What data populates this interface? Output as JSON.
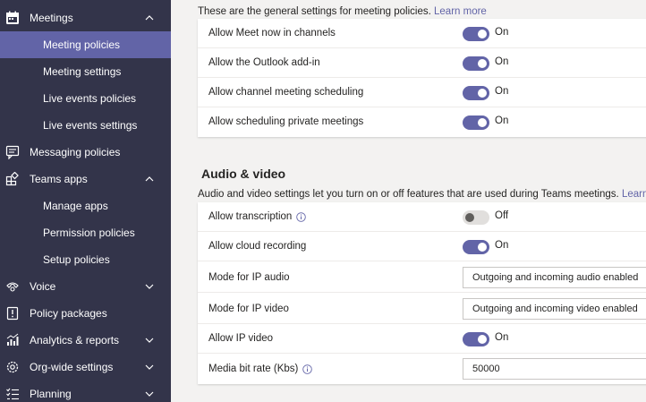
{
  "sidebar": {
    "meetings": "Meetings",
    "meeting_policies": "Meeting policies",
    "meeting_settings": "Meeting settings",
    "live_events_policies": "Live events policies",
    "live_events_settings": "Live events settings",
    "messaging_policies": "Messaging policies",
    "teams_apps": "Teams apps",
    "manage_apps": "Manage apps",
    "permission_policies": "Permission policies",
    "setup_policies": "Setup policies",
    "voice": "Voice",
    "policy_packages": "Policy packages",
    "analytics_reports": "Analytics & reports",
    "org_wide_settings": "Org-wide settings",
    "planning": "Planning"
  },
  "general": {
    "description": "These are the general settings for meeting policies.",
    "learn_more": "Learn more",
    "rows": [
      {
        "label": "Allow Meet now in channels",
        "state": "On"
      },
      {
        "label": "Allow the Outlook add-in",
        "state": "On"
      },
      {
        "label": "Allow channel meeting scheduling",
        "state": "On"
      },
      {
        "label": "Allow scheduling private meetings",
        "state": "On"
      }
    ]
  },
  "audio_video": {
    "title": "Audio & video",
    "description": "Audio and video settings let you turn on or off features that are used during Teams meetings.",
    "learn_more": "Learn more",
    "transcription_label": "Allow transcription",
    "transcription_state": "Off",
    "cloud_recording_label": "Allow cloud recording",
    "cloud_recording_state": "On",
    "ip_audio_label": "Mode for IP audio",
    "ip_audio_value": "Outgoing and incoming audio enabled",
    "ip_video_label": "Mode for IP video",
    "ip_video_value": "Outgoing and incoming video enabled",
    "allow_ip_video_label": "Allow IP video",
    "allow_ip_video_state": "On",
    "bitrate_label": "Media bit rate (Kbs)",
    "bitrate_value": "50000"
  },
  "colors": {
    "sidebar_bg": "#33344a",
    "selected_bg": "#6264a7",
    "accent": "#6264a7"
  }
}
